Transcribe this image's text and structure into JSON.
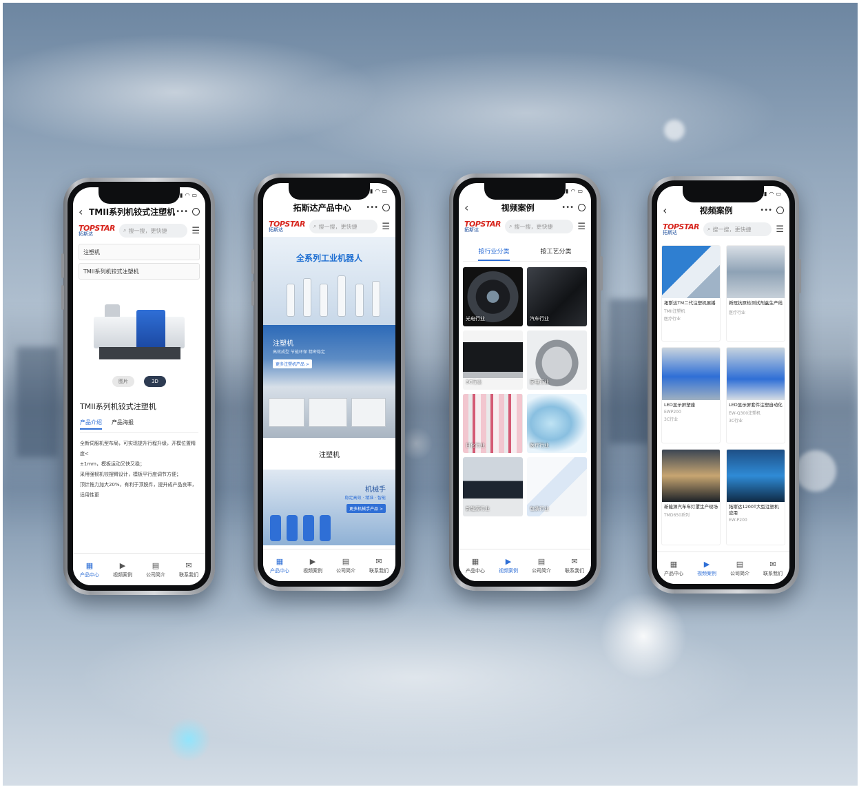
{
  "phones": [
    {
      "title": "TMII系列机铰式注塑机",
      "search_placeholder": "搜一搜，更快捷",
      "logo_top": "TOPSTAR",
      "logo_bottom": "拓斯达",
      "select1": "注塑机",
      "select2": "TMII系列机铰式注塑机",
      "pill_left": "图片",
      "pill_right": "3D",
      "product_name": "TMII系列机铰式注塑机",
      "tab_intro": "产品介绍",
      "tab_poster": "产品海报",
      "desc_lines": [
        "全新伺服机型布局，可实现提升行程升级，开模位置精度<",
        "±1mm，模板运动又快又稳；",
        "采用强韧机铰摆臂设计，模板平行度调节方便；",
        "顶针推力加大20%，有利于顶脱件，提升成产品良率，适用性更"
      ],
      "tabs": [
        "产品中心",
        "视频案例",
        "公司简介",
        "联系我们"
      ],
      "active_tab": 0
    },
    {
      "title": "拓斯达产品中心",
      "search_placeholder": "搜一搜，更快捷",
      "logo_top": "TOPSTAR",
      "logo_bottom": "拓斯达",
      "banner1_title": "全系列工业机器人",
      "banner2_title": "注塑机",
      "banner2_sub": "高效成型 节能环保 精密稳定",
      "banner2_btn": "更多注塑机产品 >",
      "caption": "注塑机",
      "banner3_title": "机械手",
      "banner3_sub": "稳定高效 · 精准 · 智能",
      "banner3_btn": "更多机械手产品 >",
      "tabs": [
        "产品中心",
        "视频案例",
        "公司简介",
        "联系我们"
      ],
      "active_tab": 0
    },
    {
      "title": "视频案例",
      "search_placeholder": "搜一搜，更快捷",
      "logo_top": "TOPSTAR",
      "logo_bottom": "拓斯达",
      "cat_tab1": "按行业分类",
      "cat_tab2": "按工艺分类",
      "tiles": [
        "光电行业",
        "汽车行业",
        "3C行业",
        "家电行业",
        "日化行业",
        "医疗行业",
        "新能源行业",
        "包装行业"
      ],
      "tabs": [
        "产品中心",
        "视频案例",
        "公司简介",
        "联系我们"
      ],
      "active_tab": 1
    },
    {
      "title": "视频案例",
      "search_placeholder": "搜一搜，更快捷",
      "logo_top": "TOPSTAR",
      "logo_bottom": "拓斯达",
      "cases": [
        {
          "title": "拓斯达TM二代注塑机展播",
          "meta1": "TMII注塑机",
          "meta2": "医疗行业"
        },
        {
          "title": "新冠抗原检测试剂盒生产线",
          "meta1": "",
          "meta2": "医疗行业"
        },
        {
          "title": "LED显示屏塑座",
          "meta1": "EWP200",
          "meta2": "3C行业"
        },
        {
          "title": "LED显示屏套件注塑自动化",
          "meta1": "EW-Q300注塑机",
          "meta2": "3C行业"
        },
        {
          "title": "新能源汽车车灯罩生产现场",
          "meta1": "TMD650系列",
          "meta2": ""
        },
        {
          "title": "拓斯达1200T大型注塑机应用",
          "meta1": "EW-P200",
          "meta2": ""
        }
      ],
      "tabs": [
        "产品中心",
        "视频案例",
        "公司简介",
        "联系我们"
      ],
      "active_tab": 1
    }
  ]
}
